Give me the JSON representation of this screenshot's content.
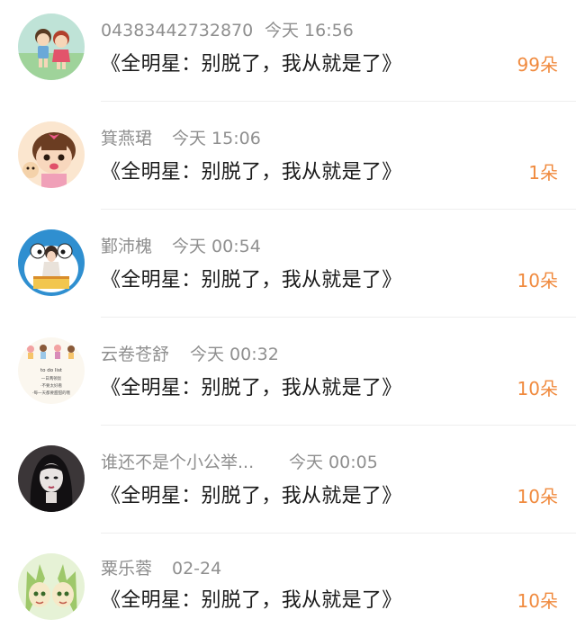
{
  "comments": [
    {
      "user": "04383442732870",
      "time": "今天 16:56",
      "message": "《全明星：别脱了，我从就是了》",
      "flowers": "99朵",
      "avatar": "cartoon-kids-avatar"
    },
    {
      "user": "箕燕珺",
      "time": "今天 15:06",
      "message": "《全明星：别脱了，我从就是了》",
      "flowers": "1朵",
      "avatar": "cartoon-girl-avatar"
    },
    {
      "user": "鄞沛槐",
      "time": "今天 00:54",
      "message": "《全明星：别脱了，我从就是了》",
      "flowers": "10朵",
      "avatar": "doraemon-girl-avatar"
    },
    {
      "user": "云卷苍舒",
      "time": "今天 00:32",
      "message": "《全明星：别脱了，我从就是了》",
      "flowers": "10朵",
      "avatar": "todo-list-avatar",
      "avatar_text": [
        "to do list",
        "一日两顿饭",
        "·不要太好看",
        "·每一天都要甜甜的哦"
      ]
    },
    {
      "user": "谁还不是个小公举...",
      "time": "今天 00:05",
      "message": "《全明星：别脱了，我从就是了》",
      "flowers": "10朵",
      "avatar": "dark-hair-girl-avatar"
    },
    {
      "user": "粟乐蓉",
      "time": "02-24",
      "message": "《全明星：别脱了，我从就是了》",
      "flowers": "10朵",
      "avatar": "green-elf-avatar"
    }
  ],
  "colors": {
    "meta": "#8f8f8f",
    "message": "#1a1a1a",
    "flowers": "#f08a3e",
    "divider": "#eeeeee"
  }
}
